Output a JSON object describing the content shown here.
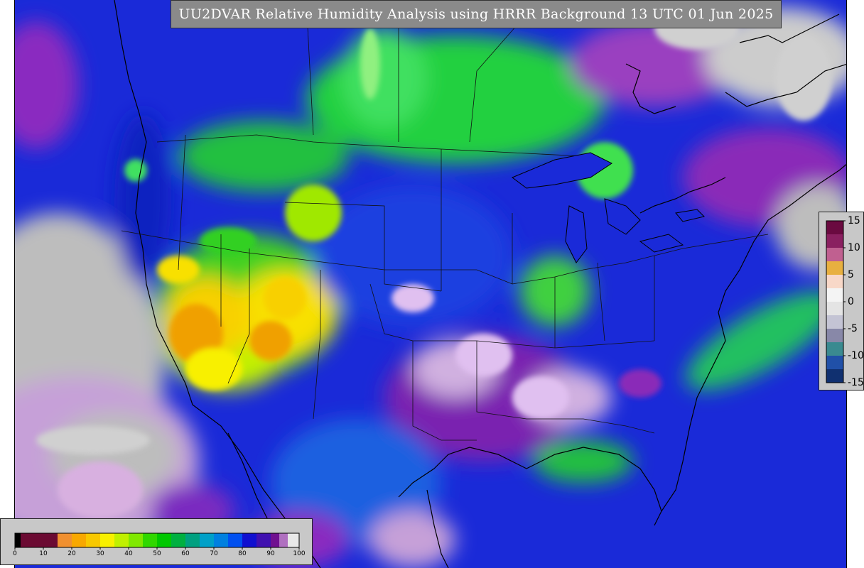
{
  "title": "UU2DVAR Relative Humidity Analysis using HRRR Background 13 UTC 01 Jun 2025",
  "rh_colorbar": {
    "ticks": [
      "0",
      "10",
      "20",
      "30",
      "40",
      "50",
      "60",
      "70",
      "80",
      "90",
      "100"
    ],
    "range": [
      0,
      100
    ],
    "colors": [
      {
        "from": 0,
        "to": 2,
        "color": "#000000"
      },
      {
        "from": 2,
        "to": 15,
        "color": "#6b0a32"
      },
      {
        "from": 15,
        "to": 20,
        "color": "#f09030"
      },
      {
        "from": 20,
        "to": 25,
        "color": "#f8a800"
      },
      {
        "from": 25,
        "to": 30,
        "color": "#f8c800"
      },
      {
        "from": 30,
        "to": 35,
        "color": "#f8f000"
      },
      {
        "from": 35,
        "to": 40,
        "color": "#c0f000"
      },
      {
        "from": 40,
        "to": 45,
        "color": "#80e800"
      },
      {
        "from": 45,
        "to": 50,
        "color": "#30d800"
      },
      {
        "from": 50,
        "to": 55,
        "color": "#00c800"
      },
      {
        "from": 55,
        "to": 60,
        "color": "#00b040"
      },
      {
        "from": 60,
        "to": 65,
        "color": "#00a080"
      },
      {
        "from": 65,
        "to": 70,
        "color": "#00a0c8"
      },
      {
        "from": 70,
        "to": 75,
        "color": "#0080e0"
      },
      {
        "from": 75,
        "to": 80,
        "color": "#0050f0"
      },
      {
        "from": 80,
        "to": 85,
        "color": "#1010d0"
      },
      {
        "from": 85,
        "to": 90,
        "color": "#4010b0"
      },
      {
        "from": 90,
        "to": 93,
        "color": "#701090"
      },
      {
        "from": 93,
        "to": 96,
        "color": "#b070c0"
      },
      {
        "from": 96,
        "to": 100,
        "color": "#e8e8e8"
      }
    ]
  },
  "diff_colorbar": {
    "ticks": [
      "15",
      "10",
      "5",
      "0",
      "-5",
      "-10",
      "-15"
    ],
    "range": [
      -15,
      15
    ],
    "colors": [
      {
        "from": 12.5,
        "to": 15,
        "color": "#6a0a40"
      },
      {
        "from": 10,
        "to": 12.5,
        "color": "#8a2060"
      },
      {
        "from": 7.5,
        "to": 10,
        "color": "#c06090"
      },
      {
        "from": 5,
        "to": 7.5,
        "color": "#e8b040"
      },
      {
        "from": 2.5,
        "to": 5,
        "color": "#f8d8c8"
      },
      {
        "from": 0,
        "to": 2.5,
        "color": "#f4f4f4"
      },
      {
        "from": -2.5,
        "to": 0,
        "color": "#e4e4e4"
      },
      {
        "from": -5,
        "to": -2.5,
        "color": "#c4c4d4"
      },
      {
        "from": -7.5,
        "to": -5,
        "color": "#8888a8"
      },
      {
        "from": -10,
        "to": -7.5,
        "color": "#3a8a90"
      },
      {
        "from": -12.5,
        "to": -10,
        "color": "#2050a8"
      },
      {
        "from": -15,
        "to": -12.5,
        "color": "#103070"
      }
    ]
  },
  "colors": {
    "ocean_base": "#1a2ad8",
    "title_bg": "#8a8a8a",
    "panel_bg": "#c8c8c8"
  }
}
